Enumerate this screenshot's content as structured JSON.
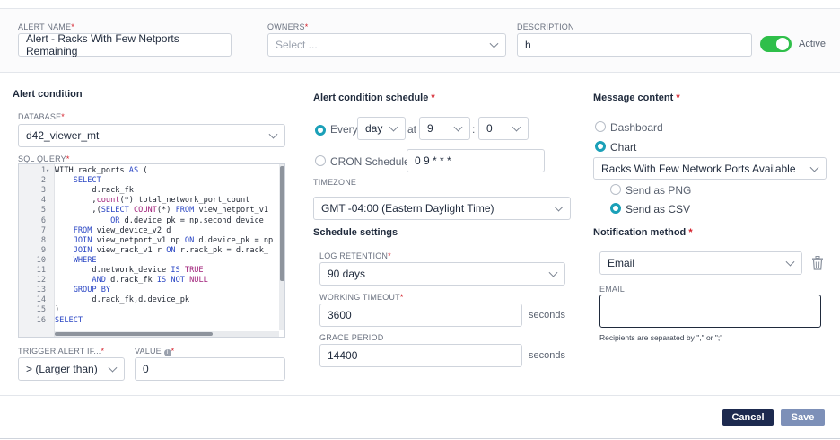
{
  "header": {
    "alert_name_label": "ALERT NAME",
    "alert_name_value": "Alert - Racks With Few Netports Remaining",
    "owners_label": "OWNERS",
    "owners_placeholder": "Select ...",
    "description_label": "DESCRIPTION",
    "description_value": "h",
    "active_label": "Active",
    "active_on": true
  },
  "alert_condition": {
    "title": "Alert condition",
    "database_label": "DATABASE",
    "database_value": "d42_viewer_mt",
    "sql_label": "SQL QUERY",
    "sql_lines": [
      {
        "n": "1",
        "fold": "▾",
        "tokens": [
          [
            "kw0",
            "WITH rack_ports "
          ],
          [
            "kw",
            "AS"
          ],
          [
            "kw0",
            " ("
          ]
        ]
      },
      {
        "n": "2",
        "fold": "",
        "tokens": [
          [
            "kw0",
            "    "
          ],
          [
            "kw",
            "SELECT"
          ]
        ]
      },
      {
        "n": "3",
        "fold": "",
        "tokens": [
          [
            "kw0",
            "        d.rack_fk"
          ]
        ]
      },
      {
        "n": "4",
        "fold": "",
        "tokens": [
          [
            "kw0",
            "        ,"
          ],
          [
            "kw2",
            "count"
          ],
          [
            "kw0",
            "(*) total_network_port_count"
          ]
        ]
      },
      {
        "n": "5",
        "fold": "",
        "tokens": [
          [
            "kw0",
            "        ,("
          ],
          [
            "kw",
            "SELECT"
          ],
          [
            "kw0",
            " "
          ],
          [
            "kw2",
            "COUNT"
          ],
          [
            "kw0",
            "(*) "
          ],
          [
            "kw",
            "FROM"
          ],
          [
            "kw0",
            " view_netport_v1 "
          ]
        ]
      },
      {
        "n": "6",
        "fold": "",
        "tokens": [
          [
            "kw0",
            "            "
          ],
          [
            "kw",
            "OR"
          ],
          [
            "kw0",
            " d.device_pk = np.second_device_"
          ]
        ]
      },
      {
        "n": "7",
        "fold": "",
        "tokens": [
          [
            "kw0",
            "    "
          ],
          [
            "kw",
            "FROM"
          ],
          [
            "kw0",
            " view_device_v2 d"
          ]
        ]
      },
      {
        "n": "8",
        "fold": "",
        "tokens": [
          [
            "kw0",
            "    "
          ],
          [
            "kw",
            "JOIN"
          ],
          [
            "kw0",
            " view_netport_v1 np "
          ],
          [
            "kw",
            "ON"
          ],
          [
            "kw0",
            " d.device_pk = np"
          ]
        ]
      },
      {
        "n": "9",
        "fold": "",
        "tokens": [
          [
            "kw0",
            "    "
          ],
          [
            "kw",
            "JOIN"
          ],
          [
            "kw0",
            " view_rack_v1 r "
          ],
          [
            "kw",
            "ON"
          ],
          [
            "kw0",
            " r.rack_pk = d.rack_"
          ]
        ]
      },
      {
        "n": "10",
        "fold": "",
        "tokens": [
          [
            "kw0",
            "    "
          ],
          [
            "kw",
            "WHERE"
          ]
        ]
      },
      {
        "n": "11",
        "fold": "",
        "tokens": [
          [
            "kw0",
            "        d.network_device "
          ],
          [
            "kw",
            "IS"
          ],
          [
            "kw0",
            " "
          ],
          [
            "kw2",
            "TRUE"
          ]
        ]
      },
      {
        "n": "12",
        "fold": "",
        "tokens": [
          [
            "kw0",
            "        "
          ],
          [
            "kw",
            "AND"
          ],
          [
            "kw0",
            " d.rack_fk "
          ],
          [
            "kw",
            "IS"
          ],
          [
            "kw0",
            " "
          ],
          [
            "kw",
            "NOT"
          ],
          [
            "kw0",
            " "
          ],
          [
            "kw2",
            "NULL"
          ]
        ]
      },
      {
        "n": "13",
        "fold": "",
        "tokens": [
          [
            "kw0",
            "    "
          ],
          [
            "kw",
            "GROUP BY"
          ]
        ]
      },
      {
        "n": "14",
        "fold": "",
        "tokens": [
          [
            "kw0",
            "        d.rack_fk,d.device_pk"
          ]
        ]
      },
      {
        "n": "15",
        "fold": "",
        "tokens": [
          [
            "kw0",
            ")"
          ]
        ]
      },
      {
        "n": "16",
        "fold": "",
        "tokens": [
          [
            "kw",
            "SELECT"
          ]
        ]
      }
    ],
    "trigger_label": "TRIGGER ALERT IF...",
    "trigger_value": "> (Larger than)",
    "value_label": "VALUE",
    "value_value": "0"
  },
  "schedule": {
    "title": "Alert condition schedule",
    "every_label": "Every",
    "every_unit": "day",
    "at_label": "at",
    "hour": "9",
    "colon": ":",
    "minute": "0",
    "cron_label": "CRON Schedule",
    "cron_value": "0 9 * * *",
    "timezone_label": "TIMEZONE",
    "timezone_value": "GMT -04:00 (Eastern Daylight Time)",
    "settings_title": "Schedule settings",
    "log_retention_label": "LOG RETENTION",
    "log_retention_value": "90 days",
    "working_timeout_label": "WORKING TIMEOUT",
    "working_timeout_value": "3600",
    "grace_period_label": "GRACE PERIOD",
    "grace_period_value": "14400",
    "seconds_label": "seconds"
  },
  "message": {
    "title": "Message content",
    "dashboard_label": "Dashboard",
    "chart_label": "Chart",
    "chart_value": "Racks With Few Network Ports Available",
    "png_label": "Send as PNG",
    "csv_label": "Send as CSV",
    "notification_title": "Notification method",
    "method_value": "Email",
    "email_label": "EMAIL",
    "email_value": "",
    "recipients_hint": "Recipients are separated by \",\" or \";\""
  },
  "footer": {
    "cancel_label": "Cancel",
    "save_label": "Save"
  },
  "colors": {
    "accent": "#1ba0b8",
    "toggle": "#2fbf4a",
    "cancel": "#1d2a4f",
    "save": "#7d90b8"
  }
}
